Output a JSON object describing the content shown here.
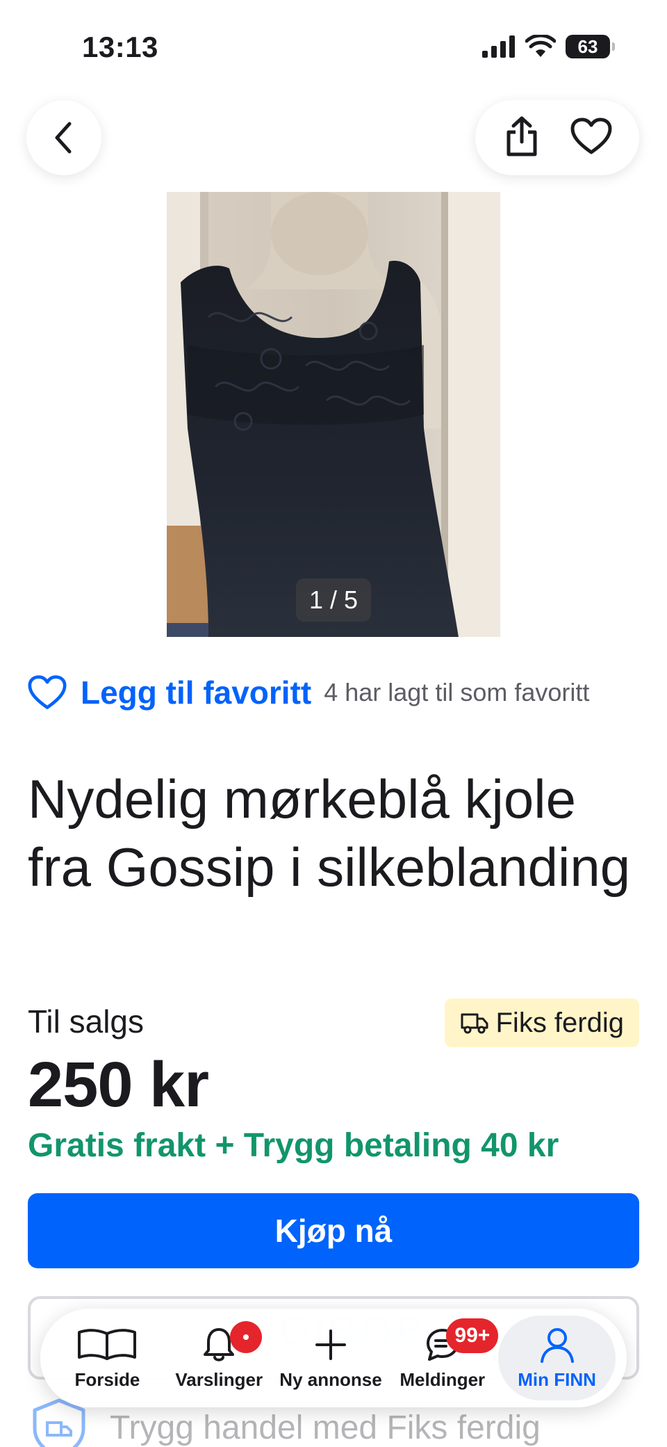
{
  "status_bar": {
    "time": "13:13",
    "battery": "63"
  },
  "gallery": {
    "counter": "1 / 5"
  },
  "favorite": {
    "link": "Legg til favoritt",
    "count_text": "4 har lagt til som favoritt"
  },
  "listing": {
    "title": "Nydelig mørkeblå kjole fra Gossip i silkeblanding",
    "sale_label": "Til salgs",
    "badge": "Fiks ferdig",
    "price": "250 kr",
    "shipping": "Gratis frakt + Trygg betaling 40 kr",
    "buy_label": "Kjøp nå",
    "safe_trade": "Trygg handel med Fiks ferdig"
  },
  "nav": {
    "items": [
      {
        "label": "Forside",
        "icon": "book-icon"
      },
      {
        "label": "Varslinger",
        "icon": "bell-icon"
      },
      {
        "label": "Ny annonse",
        "icon": "plus-icon"
      },
      {
        "label": "Meldinger",
        "icon": "chat-icon",
        "badge": "99+"
      },
      {
        "label": "Min FINN",
        "icon": "user-icon",
        "active": true
      }
    ]
  },
  "colors": {
    "accent": "#0063fb",
    "success": "#12956b",
    "badge_bg": "#fff5c8",
    "alert": "#e5252c"
  }
}
